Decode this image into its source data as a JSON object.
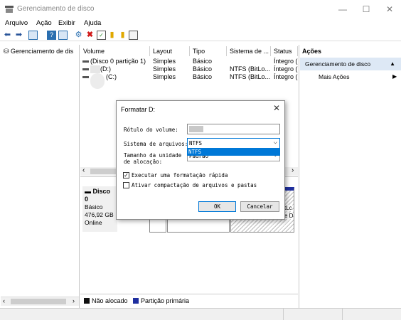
{
  "window": {
    "title": "Gerenciamento de disco",
    "min": "—",
    "max": "☐",
    "close": "✕"
  },
  "menu": [
    "Arquivo",
    "Ação",
    "Exibir",
    "Ajuda"
  ],
  "tree": {
    "root_label": "Gerenciamento de dis"
  },
  "volume_table": {
    "columns": [
      "Volume",
      "Layout",
      "Tipo",
      "Sistema de ...",
      "Status"
    ],
    "rows": [
      [
        "(Disco 0 partição 1)",
        "Simples",
        "Básico",
        "",
        "Íntegro ("
      ],
      [
        "(D:)",
        "Simples",
        "Básico",
        "NTFS (BitLo...",
        "Íntegro ("
      ],
      [
        "(C:)",
        "Simples",
        "Básico",
        "NTFS (BitLo...",
        "Íntegro ("
      ]
    ]
  },
  "disk": {
    "name": "Disco 0",
    "type": "Básico",
    "size": "476,92 GB",
    "state": "Online"
  },
  "partition_fragments": [
    "tLc",
    "e D"
  ],
  "legend": {
    "unallocated": "Não alocado",
    "primary": "Partição primária"
  },
  "actions": {
    "header": "Ações",
    "selected": "Gerenciamento de disco",
    "more": "Mais Ações"
  },
  "dialog": {
    "title": "Formatar D:",
    "volume_label_label": "Rótulo do volume:",
    "fs_label": "Sistema de arquivos:",
    "fs_value": "NTFS",
    "fs_options": [
      "NTFS"
    ],
    "alloc_label_1": "Tamanho da unidade",
    "alloc_label_2": "de alocação:",
    "alloc_value": "Padrão",
    "quick_format_label": "Executar uma formatação rápida",
    "quick_format_checked": true,
    "compression_label": "Ativar compactação de arquivos e pastas",
    "compression_checked": false,
    "ok": "OK",
    "cancel": "Cancelar"
  },
  "colors": {
    "selection": "#0078d7",
    "primary_partition": "#1f2f9f",
    "unallocated": "#111111"
  }
}
